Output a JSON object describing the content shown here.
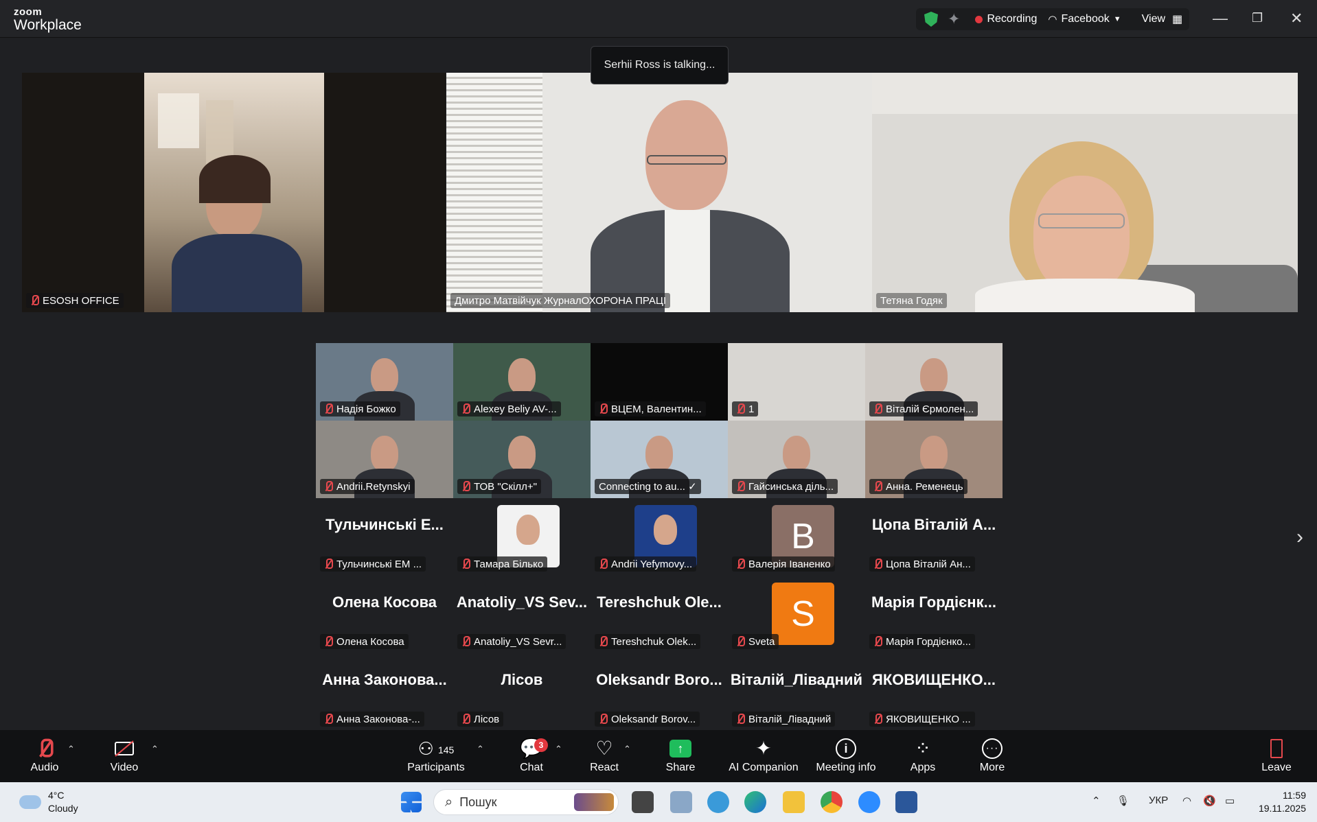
{
  "app": {
    "logo_top": "zoom",
    "logo_bottom": "Workplace"
  },
  "titlebar": {
    "recording": "Recording",
    "stream": "Facebook",
    "view": "View"
  },
  "talking": "Serhii Ross is talking...",
  "featured": [
    {
      "name": "ESOSH OFFICE",
      "muted": true
    },
    {
      "name": "Дмитро Матвійчук ЖурналОХОРОНА ПРАЦІ",
      "muted": false
    },
    {
      "name": "Тетяна Годяк",
      "muted": false
    }
  ],
  "grid": [
    {
      "name": "Надія Божко"
    },
    {
      "name": "Alexey Beliy AV-..."
    },
    {
      "name": "ВЦЕМ, Валентин..."
    },
    {
      "name": "1"
    },
    {
      "name": "Віталій Єрмолен..."
    },
    {
      "name": "Andrii.Retynskyi"
    },
    {
      "name": "ТОВ \"Скілл+\""
    },
    {
      "name": "Connecting to au... ✓"
    },
    {
      "name": "Гайсинська діль..."
    },
    {
      "name": "Анна. Ременець"
    },
    {
      "name": "Тульчинські ЕМ ...",
      "big": "Тульчинські Е..."
    },
    {
      "name": "Тамара Білько"
    },
    {
      "name": "Andrii Yefymovy..."
    },
    {
      "name": "Валерія Іваненко",
      "letter": "B"
    },
    {
      "name": "Цопа Віталій Ан...",
      "big": "Цопа Віталій А..."
    },
    {
      "name": "Олена Косова",
      "big": "Олена Косова"
    },
    {
      "name": "Anatoliy_VS Sevr...",
      "big": "Anatoliy_VS  Sev..."
    },
    {
      "name": "Tereshchuk Olek...",
      "big": "Tereshchuk  Ole..."
    },
    {
      "name": "Sveta",
      "letter": "S"
    },
    {
      "name": "Марія Гордієнко...",
      "big": "Марія Гордієнк..."
    },
    {
      "name": "Анна Законова-...",
      "big": "Анна Законова..."
    },
    {
      "name": "Лісов",
      "big": "Лісов"
    },
    {
      "name": "Oleksandr Borov...",
      "big": "Oleksandr  Boro..."
    },
    {
      "name": "Віталій_Лівадний",
      "big": "Віталій_Лівадний"
    },
    {
      "name": "ЯКОВИЩЕНКО ...",
      "big": "ЯКОВИЩЕНКО..."
    }
  ],
  "toolbar": {
    "audio": "Audio",
    "video": "Video",
    "participants": "Participants",
    "participants_count": "145",
    "chat": "Chat",
    "chat_badge": "3",
    "react": "React",
    "share": "Share",
    "ai": "AI Companion",
    "info": "Meeting info",
    "apps": "Apps",
    "more": "More",
    "leave": "Leave"
  },
  "taskbar": {
    "temp": "4°C",
    "weather": "Cloudy",
    "search_placeholder": "Пошук",
    "lang": "УКР",
    "time": "11:59",
    "date": "19.11.2025"
  },
  "colors": {
    "accent_green": "#2fb25a",
    "record_red": "#e2383f",
    "share_green": "#1fbd5c",
    "avatar_b": "#8a6f66",
    "avatar_s": "#f07a12"
  }
}
